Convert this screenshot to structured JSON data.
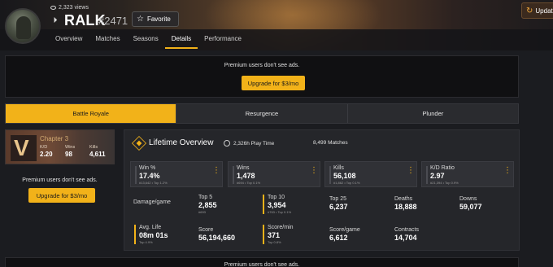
{
  "header": {
    "views": "2,323 views",
    "platform_icon": "playstation-icon",
    "player_name": "RALK",
    "player_tag": "#2471",
    "favorite_label": "Favorite",
    "update_label": "Update"
  },
  "nav": {
    "tabs": [
      {
        "label": "Overview",
        "active": false
      },
      {
        "label": "Matches",
        "active": false
      },
      {
        "label": "Seasons",
        "active": false
      },
      {
        "label": "Details",
        "active": true
      },
      {
        "label": "Performance",
        "active": false
      }
    ]
  },
  "ads": {
    "message": "Premium users don't see ads.",
    "button": "Upgrade for $3/mo"
  },
  "modes": [
    {
      "label": "Battle Royale",
      "active": true
    },
    {
      "label": "Resurgence",
      "active": false
    },
    {
      "label": "Plunder",
      "active": false
    }
  ],
  "season": {
    "chapter": "Chapter 3",
    "kd_label": "K/D",
    "kd_value": "2.20",
    "wins_label": "Wins",
    "wins_value": "98",
    "kills_label": "Kills",
    "kills_value": "4,611"
  },
  "lifetime": {
    "title": "Lifetime Overview",
    "play_time": "2,326h Play Time",
    "matches": "8,499 Matches",
    "cards": [
      {
        "label": "Win %",
        "value": "17.4%",
        "sub": "#13,642 • Top 1.2%"
      },
      {
        "label": "Wins",
        "value": "1,478",
        "sub": "#694 • Top 0.1%"
      },
      {
        "label": "Kills",
        "value": "56,108",
        "sub": "#1,862 • Top 0.1%"
      },
      {
        "label": "K/D Ratio",
        "value": "2.97",
        "sub": "#21,394 • Top 0.9%"
      }
    ],
    "stats": {
      "damage_label": "Damage/game",
      "top5_label": "Top 5",
      "top5_value": "2,855",
      "top5_sub": "#693",
      "top10_label": "Top 10",
      "top10_value": "3,954",
      "top10_sub": "#763 • Top 0.1%",
      "top25_label": "Top 25",
      "top25_value": "6,237",
      "deaths_label": "Deaths",
      "deaths_value": "18,888",
      "downs_label": "Downs",
      "downs_value": "59,077",
      "avglife_label": "Avg. Life",
      "avglife_value": "08m 01s",
      "avglife_sub": "Top 4.9%",
      "score_label": "Score",
      "score_value": "56,194,660",
      "spm_label": "Score/min",
      "spm_value": "371",
      "spm_sub": "Top 0.8%",
      "spg_label": "Score/game",
      "spg_value": "6,612",
      "contracts_label": "Contracts",
      "contracts_value": "14,704"
    }
  },
  "colors": {
    "accent": "#f2b219",
    "background": "#1b1c20",
    "panel": "#25262a"
  }
}
